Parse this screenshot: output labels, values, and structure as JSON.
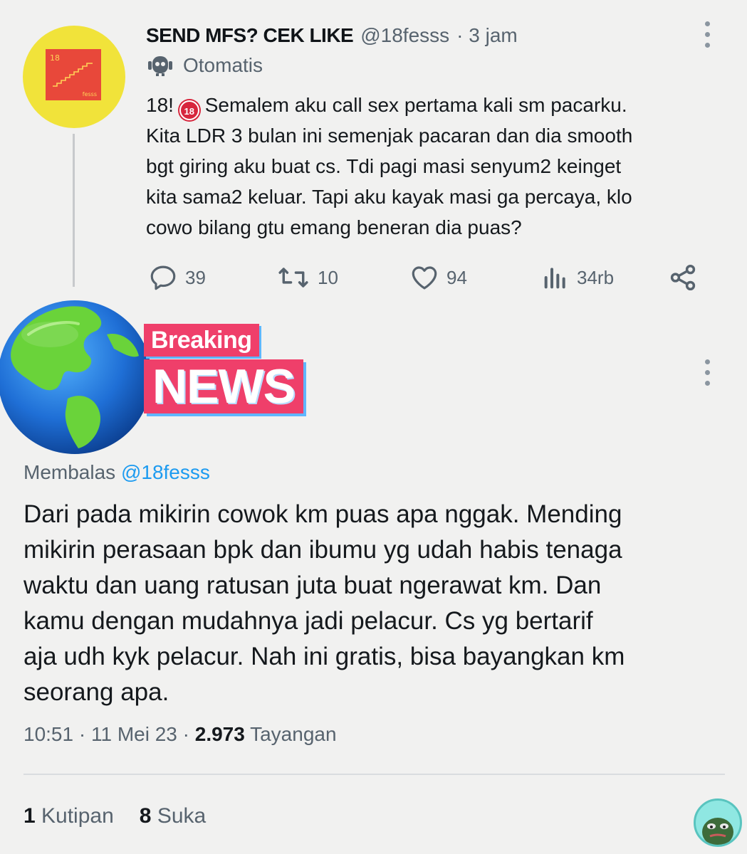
{
  "tweet": {
    "display_name": "SEND MFS? CEK LIKE",
    "handle": "@18fesss",
    "time": "· 3 jam",
    "automated_label": "Otomatis",
    "avatar": {
      "number": "18",
      "text": "fesss"
    },
    "badge": "18",
    "text_lead": "18!",
    "text": "Semalem aku call sex pertama kali sm pacarku.\nKita LDR 3 bulan ini semenjak pacaran dan dia smooth\nbgt giring aku buat cs. Tdi pagi masi senyum2 keinget\nkita sama2 keluar. Tapi aku kayak masi ga percaya, klo\ncowo bilang gtu emang beneran dia puas?",
    "replies": "39",
    "retweets": "10",
    "likes": "94",
    "views": "34rb",
    "icons": [
      "reply-icon",
      "retweet-icon",
      "like-icon",
      "views-icon",
      "share-icon",
      "more-icon",
      "robot-icon"
    ]
  },
  "reply": {
    "avatar_breaking": "Breaking",
    "avatar_news": "NEWS",
    "replying_to_label": "Membalas",
    "replying_to_handle": "@18fesss",
    "text": "Dari pada mikirin cowok km puas apa nggak. Mending\nmikirin perasaan bpk dan ibumu yg udah habis tenaga\nwaktu dan uang ratusan juta buat ngerawat km. Dan\nkamu dengan mudahnya jadi pelacur. Cs yg bertarif\naja udh kyk pelacur. Nah ini gratis, bisa bayangkan km\nseorang apa.",
    "time": "10:51",
    "date": "11 Mei 23",
    "views_count": "2.973",
    "views_label": "Tayangan",
    "quotes_count": "1",
    "quotes_label": "Kutipan",
    "likes_count": "8",
    "likes_label": "Suka"
  },
  "colors": {
    "background": "#f1f1f0",
    "secondary_text": "#57636e",
    "link": "#1d9bf0",
    "news_banner": "#ef3f6a"
  }
}
